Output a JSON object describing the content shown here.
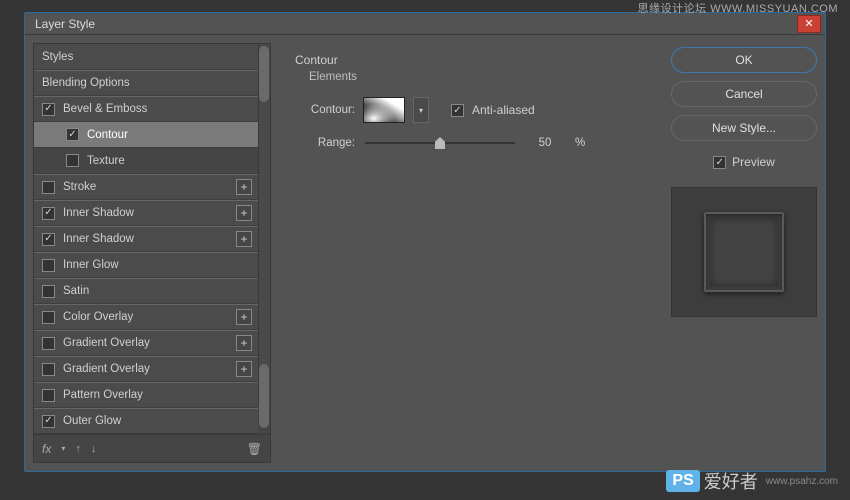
{
  "watermarks": {
    "top": "思缘设计论坛  WWW.MISSYUAN.COM",
    "bottom_logo": "PS",
    "bottom_text": "爱好者",
    "bottom_url": "www.psahz.com"
  },
  "dialog": {
    "title": "Layer Style"
  },
  "styles_list": [
    {
      "label": "Styles",
      "type": "header",
      "checkbox": null
    },
    {
      "label": "Blending Options",
      "type": "header",
      "checkbox": null
    },
    {
      "label": "Bevel & Emboss",
      "type": "row",
      "checkbox": true
    },
    {
      "label": "Contour",
      "type": "indent",
      "checkbox": true,
      "selected": true
    },
    {
      "label": "Texture",
      "type": "indent",
      "checkbox": false
    },
    {
      "label": "Stroke",
      "type": "row",
      "checkbox": false,
      "plus": true
    },
    {
      "label": "Inner Shadow",
      "type": "row",
      "checkbox": true,
      "plus": true
    },
    {
      "label": "Inner Shadow",
      "type": "row",
      "checkbox": true,
      "plus": true
    },
    {
      "label": "Inner Glow",
      "type": "row",
      "checkbox": false
    },
    {
      "label": "Satin",
      "type": "row",
      "checkbox": false
    },
    {
      "label": "Color Overlay",
      "type": "row",
      "checkbox": false,
      "plus": true
    },
    {
      "label": "Gradient Overlay",
      "type": "row",
      "checkbox": false,
      "plus": true
    },
    {
      "label": "Gradient Overlay",
      "type": "row",
      "checkbox": false,
      "plus": true
    },
    {
      "label": "Pattern Overlay",
      "type": "row",
      "checkbox": false
    },
    {
      "label": "Outer Glow",
      "type": "row",
      "checkbox": true
    }
  ],
  "settings": {
    "section_title": "Contour",
    "subsection_title": "Elements",
    "contour_label": "Contour:",
    "anti_aliased_label": "Anti-aliased",
    "anti_aliased_checked": true,
    "range_label": "Range:",
    "range_value": "50",
    "range_unit": "%",
    "range_pos": 50
  },
  "right": {
    "ok": "OK",
    "cancel": "Cancel",
    "new_style": "New Style...",
    "preview_label": "Preview",
    "preview_checked": true
  },
  "footer_icons": {
    "fx": "fx",
    "up": "↑",
    "down": "↓",
    "trash": "🗑"
  }
}
